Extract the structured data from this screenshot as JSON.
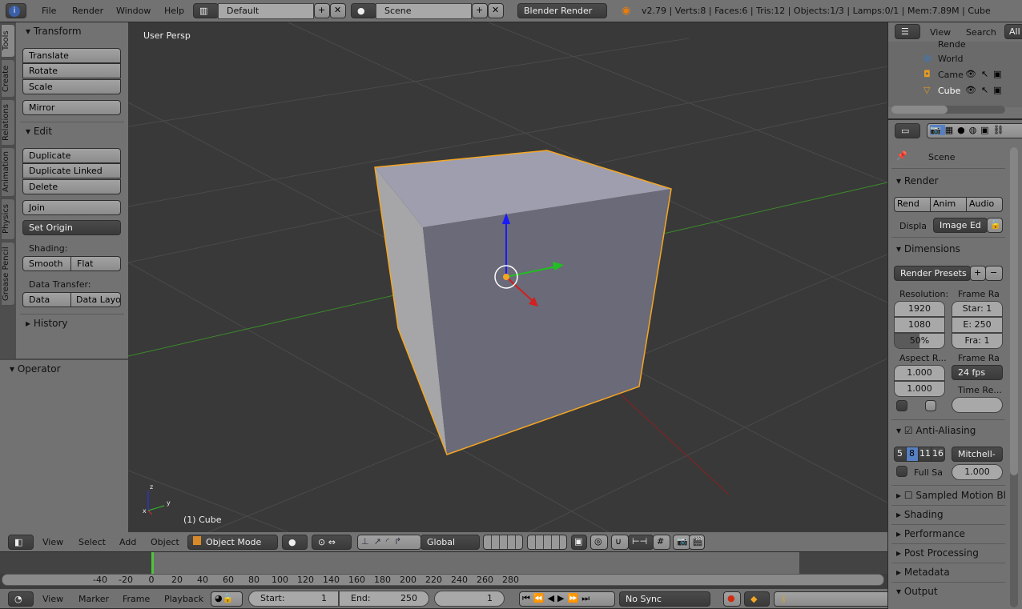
{
  "topbar": {
    "menus": [
      "File",
      "Render",
      "Window",
      "Help"
    ],
    "layout": "Default",
    "scene": "Scene",
    "engine": "Blender Render",
    "stats": "v2.79 | Verts:8 | Faces:6 | Tris:12 | Objects:1/3 | Lamps:0/1 | Mem:7.89M | Cube"
  },
  "tabs": [
    "Tools",
    "Create",
    "Relations",
    "Animation",
    "Physics",
    "Grease Pencil"
  ],
  "tools": {
    "transform": "Transform",
    "translate": "Translate",
    "rotate": "Rotate",
    "scale": "Scale",
    "mirror": "Mirror",
    "edit": "Edit",
    "duplicate": "Duplicate",
    "duplicate_linked": "Duplicate Linked",
    "delete": "Delete",
    "join": "Join",
    "set_origin": "Set Origin",
    "shading": "Shading:",
    "smooth": "Smooth",
    "flat": "Flat",
    "data_transfer": "Data Transfer:",
    "data": "Data",
    "data_layo": "Data Layo",
    "history": "History",
    "operator": "Operator"
  },
  "viewport": {
    "view_name": "User Persp",
    "object_label": "(1) Cube",
    "axis_x": "x",
    "axis_y": "y",
    "axis_z": "z"
  },
  "view3d_header": {
    "menus": [
      "View",
      "Select",
      "Add",
      "Object"
    ],
    "mode": "Object Mode",
    "orientation": "Global"
  },
  "timeline": {
    "ticks": [
      "-40",
      "-20",
      "0",
      "20",
      "40",
      "60",
      "80",
      "100",
      "120",
      "140",
      "160",
      "180",
      "200",
      "220",
      "240",
      "260",
      "280"
    ],
    "menus": [
      "View",
      "Marker",
      "Frame",
      "Playback"
    ],
    "start_label": "Start:",
    "start": "1",
    "end_label": "End:",
    "end": "250",
    "current": "1",
    "sync": "No Sync"
  },
  "outliner": {
    "view": "View",
    "search": "Search",
    "all": "All",
    "items": [
      "Rende",
      "World",
      "Came",
      "Cube"
    ]
  },
  "properties": {
    "scene": "Scene",
    "render": "Render",
    "rend": "Rend",
    "anim": "Anim",
    "audio": "Audio",
    "displa": "Displa",
    "image_ed": "Image Ed",
    "dimensions": "Dimensions",
    "render_presets": "Render Presets",
    "resolution": "Resolution:",
    "res_x": "1920",
    "res_y": "1080",
    "res_pct": "50%",
    "frame_range": "Frame Ra",
    "start": "Star: 1",
    "end": "E: 250",
    "frame": "Fra: 1",
    "aspect": "Aspect R...",
    "asp_x": "1.000",
    "asp_y": "1.000",
    "frame_rate": "Frame Ra",
    "fps": "24 fps",
    "time_remap": "Time Re...",
    "anti_aliasing": "Anti-Aliasing",
    "aa_samples": [
      "5",
      "8",
      "11",
      "16"
    ],
    "aa_selected": "8",
    "filter": "Mitchell-",
    "full_sample": "Full Sa",
    "filter_size": "1.000",
    "sampled_motion": "Sampled Motion Bl",
    "shading": "Shading",
    "performance": "Performance",
    "post_processing": "Post Processing",
    "metadata": "Metadata",
    "output": "Output"
  },
  "colors": {
    "accent": "#5680c2",
    "selection": "#f5a623",
    "x_axis": "#c03030",
    "y_axis": "#30a030"
  }
}
